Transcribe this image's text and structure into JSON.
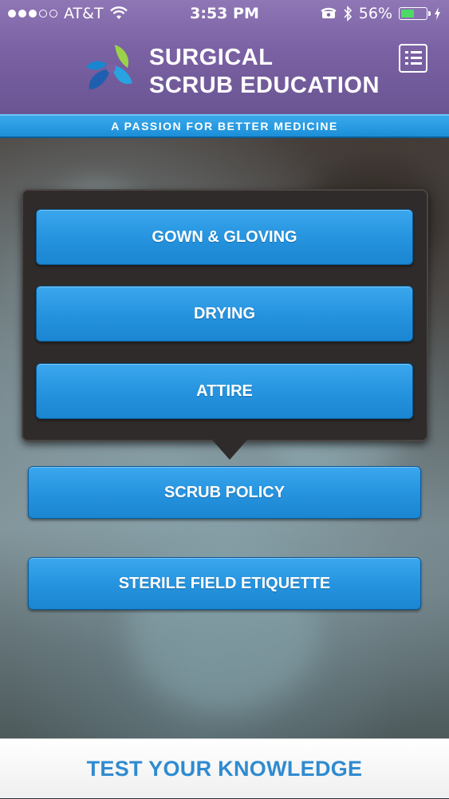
{
  "status_bar": {
    "signal_dots_full": 3,
    "signal_dots_total": 5,
    "carrier": "AT&T",
    "time": "3:53 PM",
    "battery_percent": "56%",
    "battery_level": 0.56,
    "icons": [
      "wifi-icon",
      "phone-icon",
      "bluetooth-icon",
      "charging-icon"
    ]
  },
  "header": {
    "title_line1": "SURGICAL",
    "title_line2": "SCRUB EDUCATION",
    "tagline": "A PASSION FOR BETTER MEDICINE",
    "menu_icon": "list-menu-icon"
  },
  "popover": {
    "items": [
      {
        "label": "GOWN & GLOVING"
      },
      {
        "label": "DRYING"
      },
      {
        "label": "ATTIRE"
      }
    ]
  },
  "main_buttons": [
    {
      "label": "SCRUB POLICY"
    },
    {
      "label": "STERILE FIELD ETIQUETTE"
    }
  ],
  "footer": {
    "label": "TEST YOUR KNOWLEDGE"
  },
  "colors": {
    "header_purple": "#7a61a3",
    "accent_blue": "#2592de",
    "footer_text": "#2f8bd0"
  }
}
